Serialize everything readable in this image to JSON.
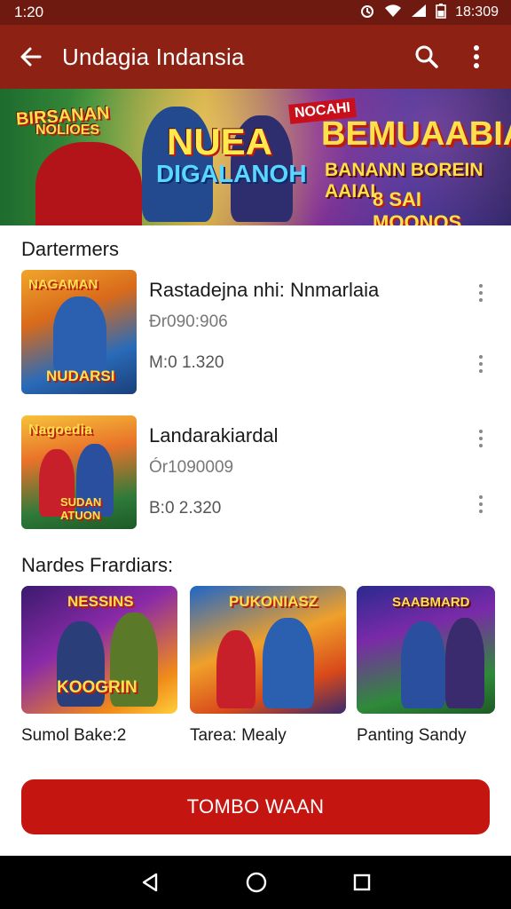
{
  "status_bar": {
    "time": "1:20",
    "clock_right": "18:309",
    "icons": [
      "alarm-icon",
      "wifi-icon",
      "signal-icon",
      "battery-icon"
    ]
  },
  "app_bar": {
    "title": "Undagia Indansia",
    "back_icon": "arrow-left-icon",
    "actions": [
      "search-icon",
      "more-vert-icon"
    ]
  },
  "banner": {
    "left_text_1": "BIRSANAN",
    "left_text_2": "NOLIOES",
    "center_text_1": "NUEA",
    "center_text_2": "DIGALANOH",
    "tag": "NOCAHI",
    "right_text_1": "BEMUAABIA",
    "right_text_2": "BANANN BOREIN AAIAI",
    "right_text_3": "8 SAI MOONOS"
  },
  "section_1": {
    "title": "Dartermers",
    "items": [
      {
        "title": "Rastadejna nhi: Nnmarlaia",
        "subtitle": "Ðr090:906",
        "meta": "M:0 1.320",
        "thumb_text_top": "NAGAMAN",
        "thumb_text_bottom": "NUDARSI"
      },
      {
        "title": "Landarakiardal",
        "subtitle": "Ór1090009",
        "meta": "B:0 2.320",
        "thumb_text_top": "Nagoedia",
        "thumb_text_bottom": "SUDAN ATUON"
      }
    ]
  },
  "section_2": {
    "title": "Nardes Frardiars:",
    "cards": [
      {
        "label": "Sumol Bake:2",
        "img_text_top": "NESSINS",
        "img_text_bottom": "KOOGRIN"
      },
      {
        "label": "Tarea: Mealy",
        "img_text_top": "PUKONIASZ",
        "img_text_bottom": ""
      },
      {
        "label": "Panting Sandy",
        "img_text_top": "SAABMARD",
        "img_text_bottom": ""
      }
    ]
  },
  "cta": {
    "label": "TOMBO WAAN"
  },
  "nav_bar": {
    "icons": [
      "back-triangle-icon",
      "home-circle-icon",
      "recents-square-icon"
    ]
  }
}
